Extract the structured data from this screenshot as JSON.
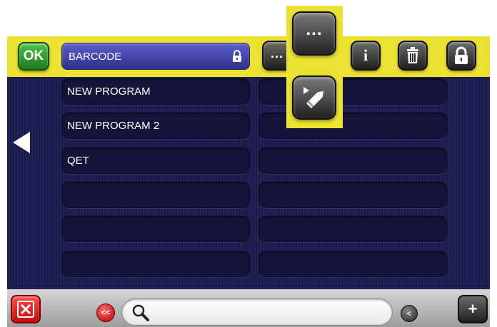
{
  "header": {
    "ok_label": "OK",
    "program_name": "BARCODE",
    "buttons": [
      {
        "icon": "ellipsis-icon",
        "label": "..."
      },
      {
        "icon": "info-icon",
        "label": "i"
      },
      {
        "icon": "trash-icon"
      },
      {
        "icon": "lock-icon"
      }
    ]
  },
  "list": {
    "left_column": [
      "NEW PROGRAM",
      "NEW PROGRAM 2",
      "QET",
      "",
      "",
      ""
    ],
    "right_column": [
      "",
      "",
      "",
      "",
      "",
      ""
    ]
  },
  "popup": {
    "items": [
      {
        "icon": "ellipsis-icon",
        "label": "..."
      },
      {
        "icon": "edit-pencil-icon"
      }
    ]
  },
  "footer": {
    "rewind_label": "<<",
    "search_value": "",
    "prev_label": "<",
    "add_label": "+"
  },
  "colors": {
    "highlight": "#ece231",
    "list_background": "#1a1a45",
    "selected_field": "#3f41a8",
    "ok_green": "#2e9c2c",
    "delete_red": "#e31b1b"
  }
}
